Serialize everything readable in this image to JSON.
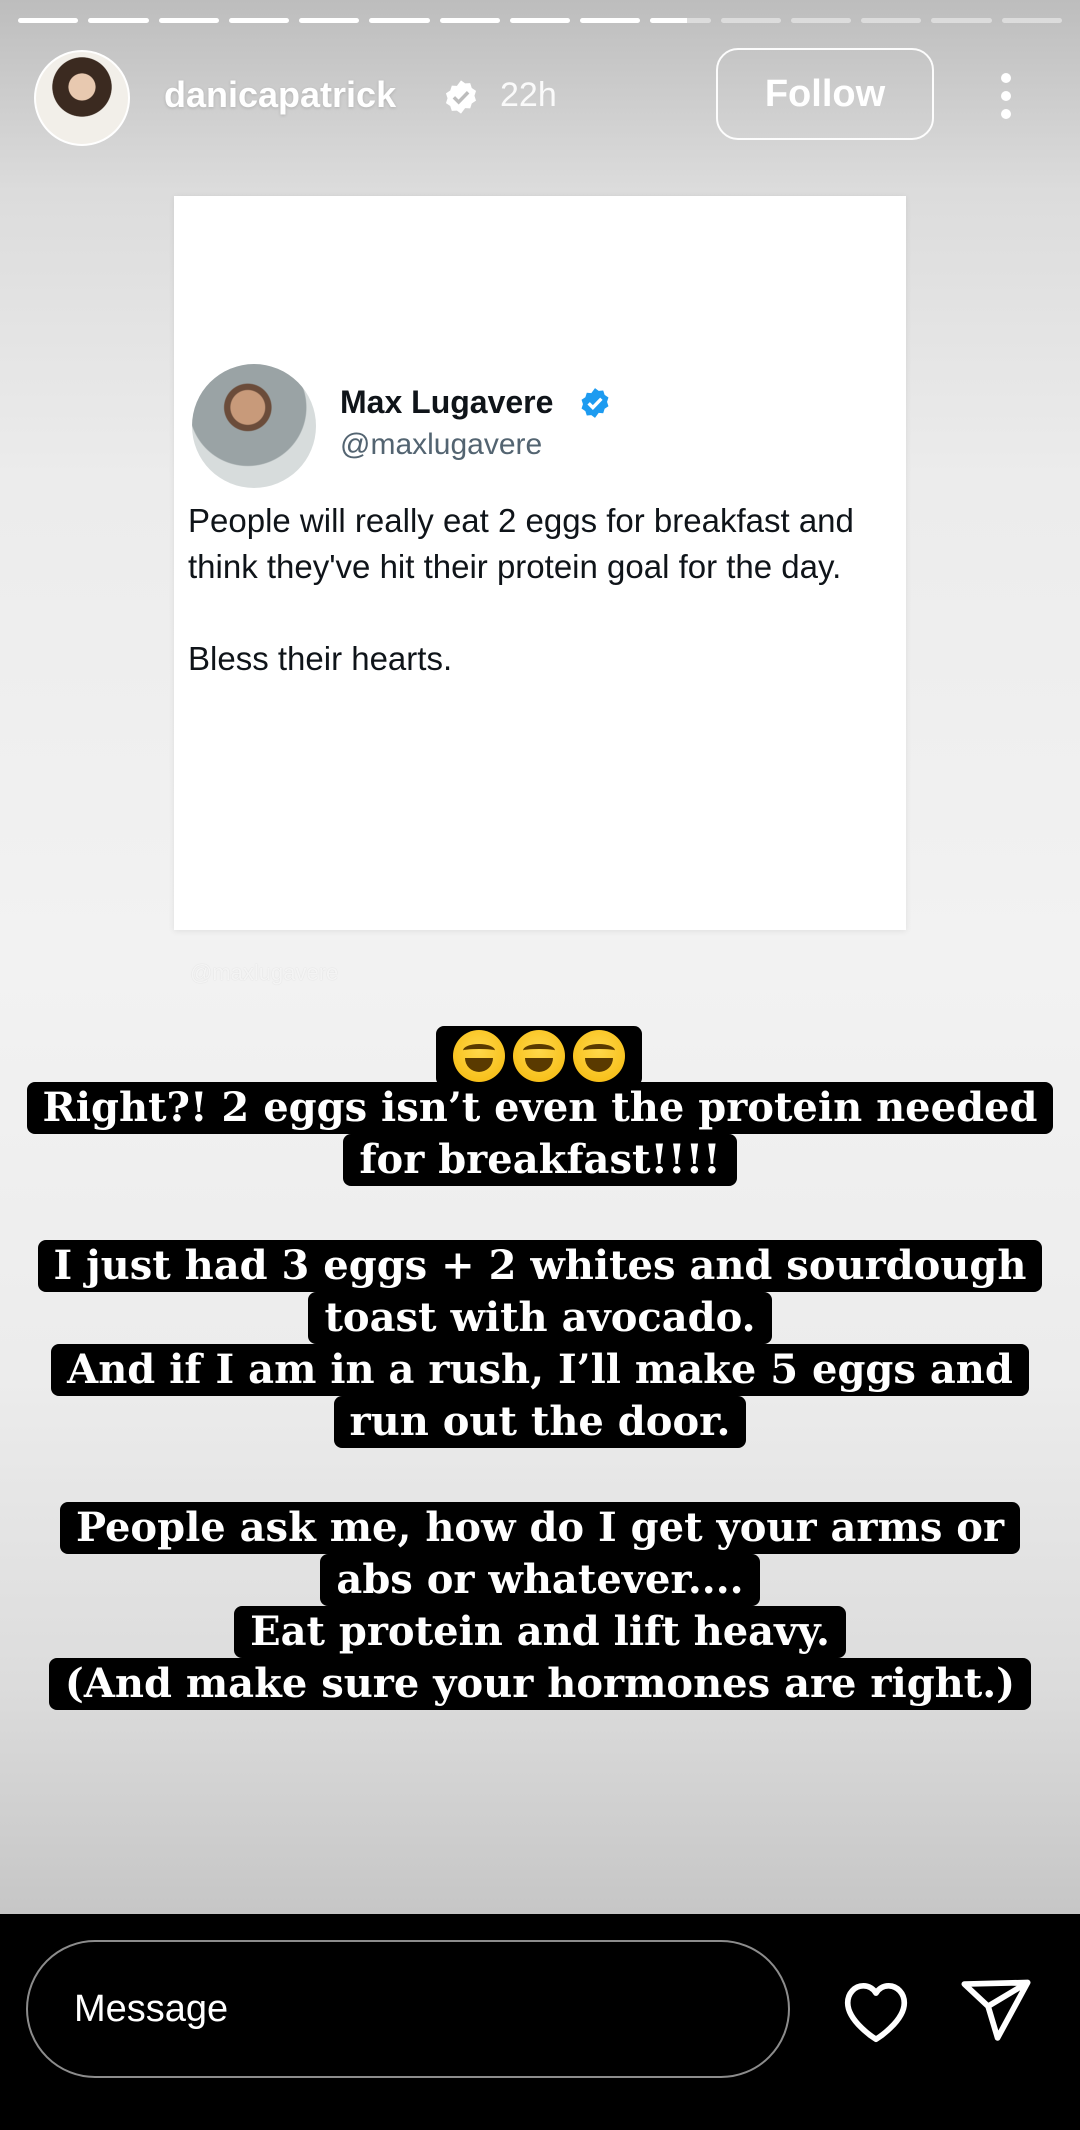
{
  "header": {
    "username": "danicapatrick",
    "time_ago": "22h",
    "follow_label": "Follow"
  },
  "progress": {
    "segments": 15,
    "current_index": 9,
    "current_fraction": 0.6
  },
  "tweet": {
    "name": "Max Lugavere",
    "handle": "@maxlugavere",
    "paragraph1": "People will really eat 2 eggs for breakfast and think they've hit their protein goal for the day.",
    "paragraph2": "Bless their hearts."
  },
  "watermark": "@maxlugavere",
  "captions": {
    "block1": [
      "Right?! 2 eggs isn’t even the protein needed",
      "for breakfast!!!!"
    ],
    "block2": [
      "I just had 3 eggs + 2 whites and sourdough",
      "toast with avocado.",
      "And if I am in a rush, I’ll make 5 eggs and",
      "run out the door."
    ],
    "block3": [
      "People ask me, how do I get your arms or",
      "abs or whatever....",
      "Eat protein and lift heavy.",
      "(And make sure your hormones are right.)"
    ]
  },
  "emojis": [
    "grinning-squinting-face",
    "grinning-squinting-face",
    "grinning-squinting-face"
  ],
  "bottom": {
    "message_placeholder": "Message"
  },
  "colors": {
    "verified_blue": "#1d9bf0",
    "caption_bg": "#000000"
  }
}
